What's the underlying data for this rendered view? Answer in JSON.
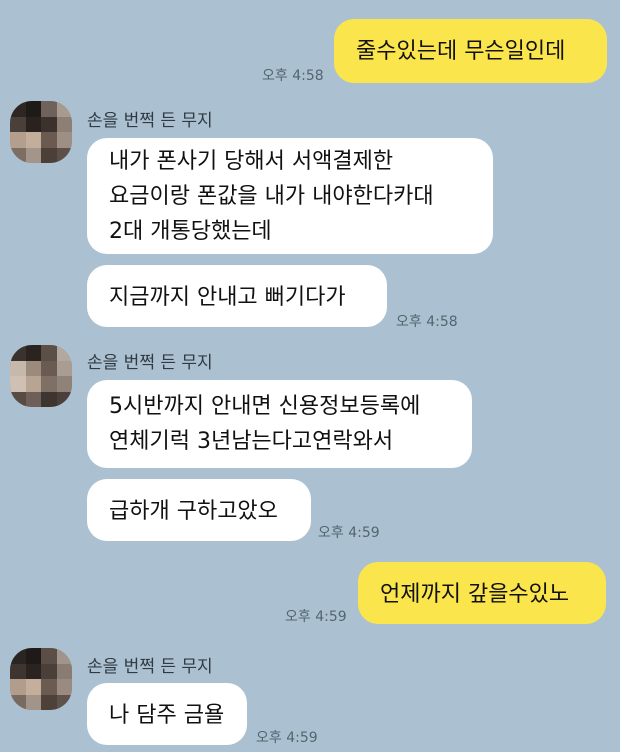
{
  "messages": [
    {
      "text": "줄수있는데 무슨일인데",
      "time": "오후 4:58"
    },
    {
      "sender": "손을 번쩍 든 무지",
      "lines": [
        "내가 폰사기 당해서 서액결제한",
        "요금이랑 폰값을 내가 내야한다카대",
        "2대 개통당했는데"
      ]
    },
    {
      "text": "지금까지 안내고 뻐기다가",
      "time": "오후 4:58"
    },
    {
      "sender": "손을 번쩍 든 무지",
      "lines": [
        "5시반까지 안내면 신용정보등록에",
        "연체기럭 3년남는다고연락와서"
      ]
    },
    {
      "text": "급하개 구하고았오",
      "time": "오후 4:59"
    },
    {
      "text": "언제까지 갚을수있노",
      "time": "오후 4:59"
    },
    {
      "sender": "손을 번쩍 든 무지",
      "text": "나 담주 금욜",
      "time": "오후 4:59"
    }
  ],
  "colors": {
    "background": "#abc1d1",
    "outgoing_bubble": "#fbe54d",
    "incoming_bubble": "#ffffff"
  }
}
